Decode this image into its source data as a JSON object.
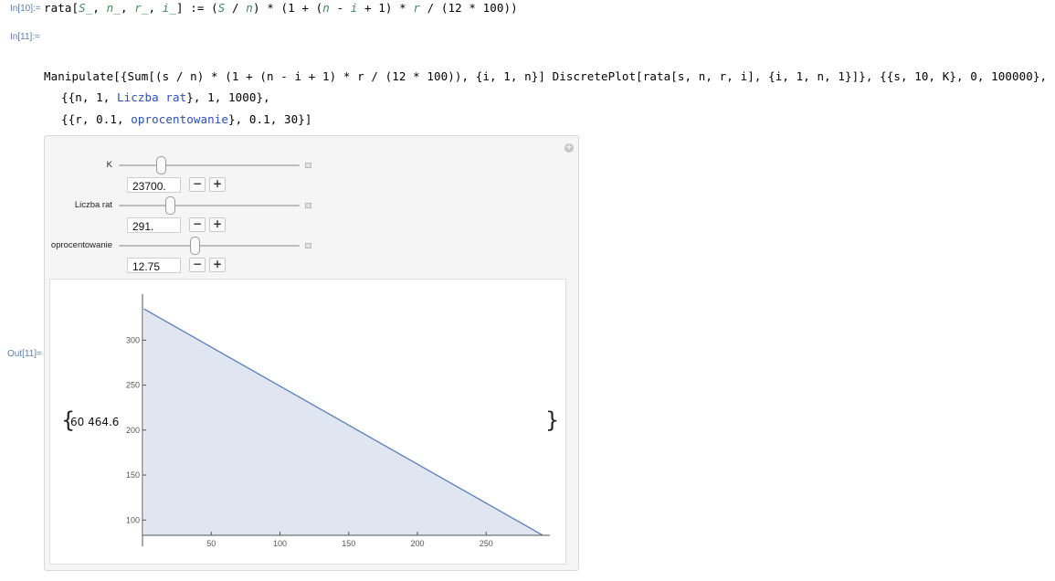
{
  "cells": {
    "in10_label": "In[10]:=",
    "in11_label": "In[11]:=",
    "out11_label": "Out[11]=",
    "def": {
      "p1": "rata[",
      "S": "S_",
      "c1": ", ",
      "n": "n_",
      "c2": ", ",
      "r": "r_",
      "c3": ", ",
      "i": "i_",
      "p2": "] := (",
      "S2": "S",
      "p3": " / ",
      "n2": "n",
      "p4": ") * (1 + (",
      "n3": "n",
      "p5": " - ",
      "i2": "i",
      "p6": " + 1) * ",
      "r2": "r",
      "p7": " / (12 * 100))"
    },
    "manip": {
      "line1_a": "Manipulate[{Sum[(s / n) * (1 + (n - i + 1) * r / (12 * 100)), {i, 1, n}] DiscretePlot[rata[s, n, r, i], {i, 1, n, 1}]}, {{s, 10, K}, 0, 100000},",
      "line2_a": "{{n, 1, ",
      "line2_sym": "Liczba rat",
      "line2_b": "}, 1, 1000},",
      "line3_a": "{{r, 0.1, ",
      "line3_sym": "oprocentowanie",
      "line3_b": "}, 0.1, 30}]"
    }
  },
  "controls": [
    {
      "label": "K",
      "value": "23700.",
      "fraction": 0.237
    },
    {
      "label": "Liczba rat",
      "value": "291.",
      "fraction": 0.29
    },
    {
      "label": "oprocentowanie",
      "value": "12.75",
      "fraction": 0.424
    }
  ],
  "buttons": {
    "minus": "−",
    "plus": "+",
    "corner_plus": "+"
  },
  "output": {
    "open_brace": "{",
    "sum_value": "60 464.6",
    "close_brace": "}"
  },
  "chart_data": {
    "type": "area",
    "x": [
      1,
      291
    ],
    "y": [
      334.8,
      83.2
    ],
    "xlim": [
      0,
      295
    ],
    "ylim": [
      83,
      340
    ],
    "xticks": [
      50,
      100,
      150,
      200,
      250
    ],
    "yticks": [
      100,
      150,
      200,
      250,
      300
    ],
    "fill_color": "#dfe6f1",
    "line_color": "#5b7fb5"
  }
}
